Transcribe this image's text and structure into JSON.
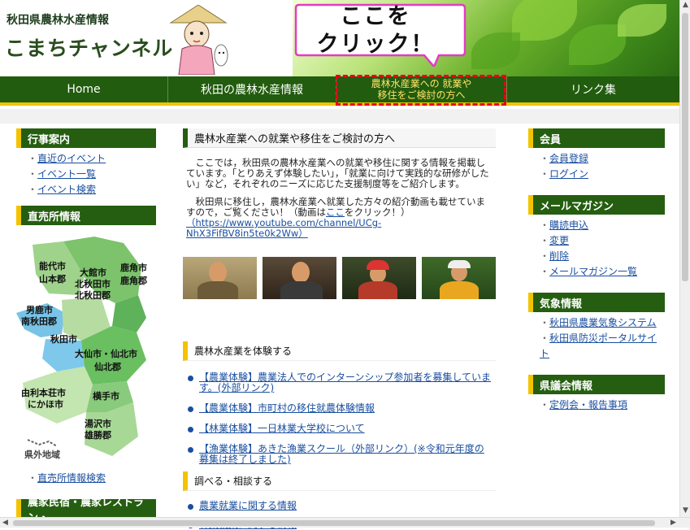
{
  "header": {
    "subtitle": "秋田県農林水産情報",
    "title": "こまちチャンネル",
    "callout_line1": "ここを",
    "callout_line2": "クリック！"
  },
  "nav": {
    "home": "Home",
    "info": "秋田の農林水産情報",
    "farm_line1": "農林水産業への 就業や",
    "farm_line2": "移住をご検討の方へ",
    "links": "リンク集"
  },
  "left": {
    "events_heading": "行事案内",
    "events": [
      "直近のイベント",
      "イベント一覧",
      "イベント検索"
    ],
    "shops_heading": "直売所情報",
    "map_labels": {
      "noshiro": "能代市",
      "yamamoto": "山本郡",
      "odate": "大館市",
      "kitaakita_city": "北秋田市",
      "kitaakita_gun": "北秋田郡",
      "kazuno_city": "鹿角市",
      "kazuno_gun": "鹿角郡",
      "oga": "男鹿市",
      "minamiakita": "南秋田郡",
      "akita": "秋田市",
      "daisen": "大仙市・仙北市",
      "senboku": "仙北郡",
      "yurihonjo": "由利本荘市",
      "nikaho": "にかほ市",
      "yokote": "横手市",
      "yuzawa": "湯沢市",
      "ogachi": "雄勝郡",
      "outside": "県外地域"
    },
    "shop_search": "直売所情報検索",
    "minshuku_heading": "農家民宿・農家レストラン・"
  },
  "main": {
    "heading": "農林水産業への就業や移住をご検討の方へ",
    "para1": "　ここでは，秋田県の農林水産業への就業や移住に関する情報を掲載しています。「とりあえず体験したい」，「就業に向けて実践的な研修がしたい」など，それぞれのニーズに応じた支援制度等をご紹介します。",
    "para2_a": "　秋田県に移住し，農林水産業へ就業した方々の紹介動画も載せていますので，ご覧ください！（動画は",
    "para2_link": "ここ",
    "para2_b": "をクリック！）",
    "video_url": "（https://www.youtube.com/channel/UCg-NhX3FifBV8in5te0k2Ww）",
    "section1": "農林水産業を体験する",
    "items1": [
      "【農業体験】農業法人でのインターンシップ参加者を募集しています。(外部リンク)",
      "【農業体験】市町村の移住就農体験情報",
      "【林業体験】一日林業大学校について",
      "【漁業体験】あきた漁業スクール（外部リンク）(※令和元年度の募集は終了しました)"
    ],
    "section2": "調べる・相談する",
    "items2": [
      "農業就業に関する情報",
      "林業就業に関する情報"
    ]
  },
  "right": {
    "member_heading": "会員",
    "member_items": [
      "会員登録",
      "ログイン"
    ],
    "mail_heading": "メールマガジン",
    "mail_items": [
      "購読申込",
      "変更",
      "削除",
      "メールマガジン一覧"
    ],
    "weather_heading": "気象情報",
    "weather_items": [
      "秋田県農業気象システム",
      "秋田県防災ポータルサイト"
    ],
    "council_heading": "県議会情報",
    "council_items": [
      "定例会・報告事項"
    ]
  }
}
